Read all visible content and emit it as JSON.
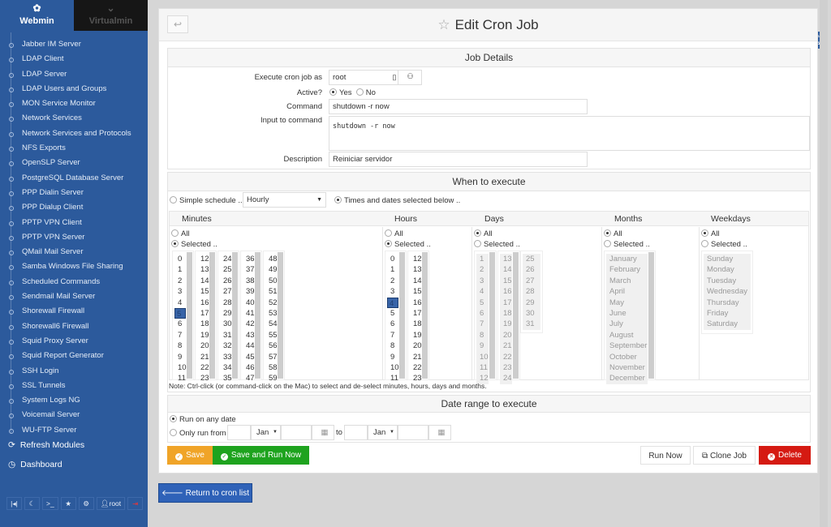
{
  "sidebar": {
    "tabs": [
      {
        "label": "Webmin",
        "icon": "webmin-logo-icon"
      },
      {
        "label": "Virtualmin",
        "icon": "chevron-down-icon"
      }
    ],
    "items": [
      "Jabber IM Server",
      "LDAP Client",
      "LDAP Server",
      "LDAP Users and Groups",
      "MON Service Monitor",
      "Network Services",
      "Network Services and Protocols",
      "NFS Exports",
      "OpenSLP Server",
      "PostgreSQL Database Server",
      "PPP Dialin Server",
      "PPP Dialup Client",
      "PPTP VPN Client",
      "PPTP VPN Server",
      "QMail Mail Server",
      "Samba Windows File Sharing",
      "Scheduled Commands",
      "Sendmail Mail Server",
      "Shorewall Firewall",
      "Shorewall6 Firewall",
      "Squid Proxy Server",
      "Squid Report Generator",
      "SSH Login",
      "SSL Tunnels",
      "System Logs NG",
      "Voicemail Server",
      "WU-FTP Server"
    ],
    "refresh": "Refresh Modules",
    "dashboard": "Dashboard",
    "toolbar_user": "root"
  },
  "page": {
    "title": "Edit Cron Job",
    "back": "↩"
  },
  "details": {
    "header": "Job Details",
    "execute_label": "Execute cron job as",
    "execute_value": "root",
    "active_label": "Active?",
    "yes": "Yes",
    "no": "No",
    "active": "Yes",
    "command_label": "Command",
    "command_value": "shutdown -r now",
    "input_label": "Input to command",
    "input_value": "shutdown -r now",
    "description_label": "Description",
    "description_value": "Reiniciar servidor"
  },
  "when": {
    "header": "When to execute",
    "simple_label": "Simple schedule ..",
    "simple_value": "Hourly",
    "times_label": "Times and dates selected below ..",
    "mode": "times",
    "columns": {
      "minutes": "Minutes",
      "hours": "Hours",
      "days": "Days",
      "months": "Months",
      "weekdays": "Weekdays"
    },
    "all": "All",
    "selected": "Selected ..",
    "minutes_selected": [
      5
    ],
    "hours_selected": [
      4
    ],
    "months": [
      "January",
      "February",
      "March",
      "April",
      "May",
      "June",
      "July",
      "August",
      "September",
      "October",
      "November",
      "December"
    ],
    "weekdays": [
      "Sunday",
      "Monday",
      "Tuesday",
      "Wednesday",
      "Thursday",
      "Friday",
      "Saturday"
    ],
    "note": "Note: Ctrl-click (or command-click on the Mac) to select and de-select minutes, hours, days and months."
  },
  "range": {
    "header": "Date range to execute",
    "any": "Run on any date",
    "only": "Only run from",
    "from_month": "Jan",
    "to": "to",
    "to_month": "Jan"
  },
  "buttons": {
    "save": "Save",
    "save_run": "Save and Run Now",
    "run_now": "Run Now",
    "clone": "Clone Job",
    "delete": "Delete",
    "return": "Return to cron list"
  },
  "colors": {
    "sidebar": "#2c5a9c",
    "save": "#f0a428",
    "save_run": "#1ea31e",
    "delete": "#d51a12",
    "return": "#2f62b8"
  }
}
